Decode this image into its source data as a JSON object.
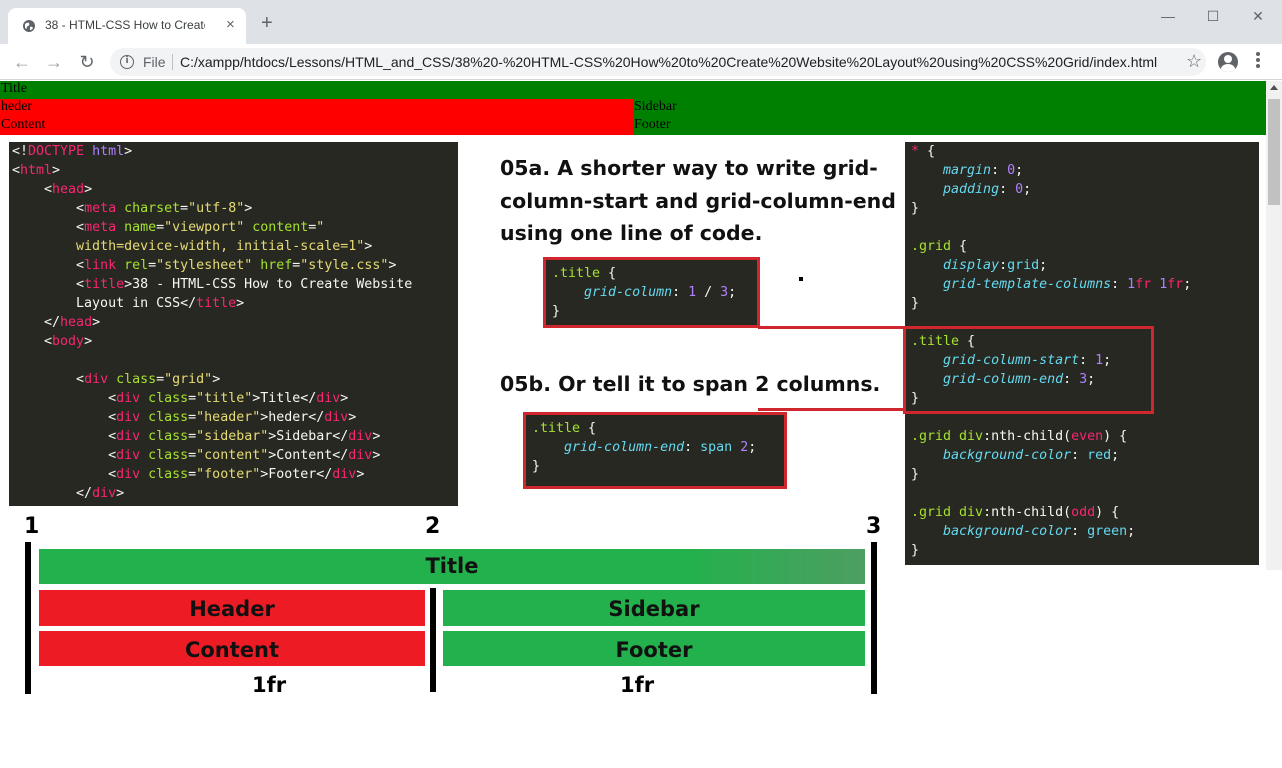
{
  "browser": {
    "tab_title": "38 - HTML-CSS How to Create W",
    "tab_close": "×",
    "new_tab": "+",
    "window_minimize": "—",
    "window_maximize": "☐",
    "window_close": "✕",
    "back": "←",
    "forward": "→",
    "reload": "↻",
    "info": "i",
    "file_label": "File",
    "url": "C:/xampp/htdocs/Lessons/HTML_and_CSS/38%20-%20HTML-CSS%20How%20to%20Create%20Website%20Layout%20using%20CSS%20Grid/index.html",
    "star": "☆"
  },
  "page": {
    "title": "Title",
    "header": "heder",
    "sidebar": "Sidebar",
    "content": "Content",
    "footer": "Footer"
  },
  "headings": {
    "h05a_line1": "05a. A shorter way to write grid-",
    "h05a_line2": "column-start and grid-column-end",
    "h05a_line3": "using one line of code.",
    "h05b": "05b. Or tell it to span 2 columns."
  },
  "diagram": {
    "col_numbers": [
      "1",
      "2",
      "3"
    ],
    "title": "Title",
    "header": "Header",
    "sidebar": "Sidebar",
    "content": "Content",
    "footer": "Footer",
    "fr_left": "1fr",
    "fr_right": "1fr"
  },
  "colors": {
    "green": "#008000",
    "red": "#ff0000",
    "diagram_green": "#22b14c",
    "diagram_red": "#ed1c24",
    "highlight": "#d0262d",
    "editor_bg": "#272822"
  }
}
